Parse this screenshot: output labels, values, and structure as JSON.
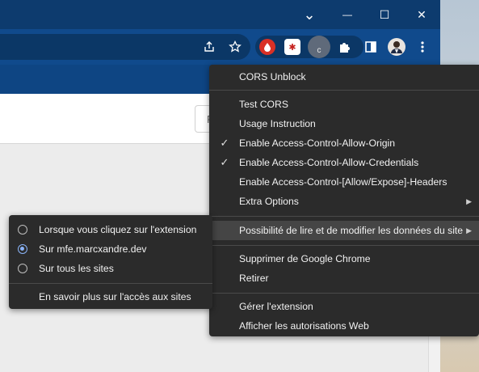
{
  "window_controls": {
    "chevron": "⌄",
    "minimize": "—",
    "maximize": "☐",
    "close": "✕"
  },
  "toolbar": {
    "share_icon": "share-icon",
    "star_icon": "bookmark-star-icon",
    "extensions": [
      {
        "icon": "red-drop-extension-icon",
        "color": "#d93025"
      },
      {
        "icon": "red-badge-extension-icon",
        "color": "#c5221f"
      },
      {
        "icon": "cors-unblock-extension-icon",
        "color": "#5f6a7a",
        "label": "c"
      },
      {
        "icon": "puzzle-icon",
        "color": "#ffffff"
      }
    ],
    "sidepanel_icon": "side-panel-icon",
    "profile_icon": "avatar",
    "menu_icon": "kebab-menu-icon"
  },
  "page": {
    "field_text": "F"
  },
  "main_menu": {
    "title": "CORS Unblock",
    "items": [
      {
        "label": "Test CORS",
        "checked": false,
        "submenu": false
      },
      {
        "label": "Usage Instruction",
        "checked": false,
        "submenu": false
      },
      {
        "label": "Enable Access-Control-Allow-Origin",
        "checked": true,
        "submenu": false
      },
      {
        "label": "Enable Access-Control-Allow-Credentials",
        "checked": true,
        "submenu": false
      },
      {
        "label": "Enable Access-Control-[Allow/Expose]-Headers",
        "checked": false,
        "submenu": false
      },
      {
        "label": "Extra Options",
        "checked": false,
        "submenu": true
      }
    ],
    "site_access": "Possibilité de lire et de modifier les données du site",
    "remove_chrome": "Supprimer de Google Chrome",
    "hide": "Retirer",
    "manage": "Gérer l'extension",
    "permissions": "Afficher les autorisations Web",
    "checkmark": "✓",
    "arrow": "▶"
  },
  "site_access_menu": {
    "options": [
      {
        "label": "Lorsque vous cliquez sur l'extension",
        "selected": false
      },
      {
        "label": "Sur mfe.marcxandre.dev",
        "selected": true
      },
      {
        "label": "Sur tous les sites",
        "selected": false
      }
    ],
    "learn_more": "En savoir plus sur l'accès aux sites"
  }
}
